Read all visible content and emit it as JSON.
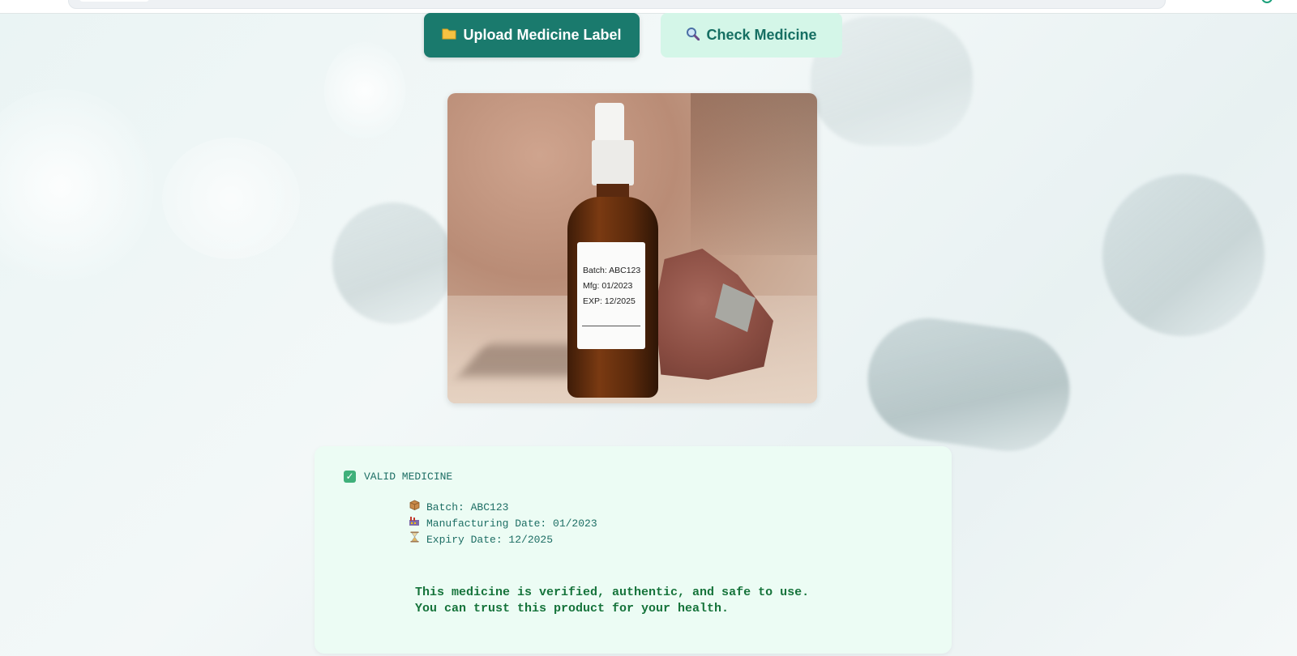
{
  "actions": {
    "upload_label": "Upload Medicine Label",
    "upload_icon": "folder-icon",
    "check_label": "Check Medicine",
    "check_icon": "magnifier-icon"
  },
  "photo_label": {
    "batch": "Batch: ABC123",
    "mfg": "Mfg: 01/2023",
    "exp": "EXP: 12/2025"
  },
  "result": {
    "status_text": "VALID MEDICINE",
    "status_color": "#3fb07a",
    "details": [
      {
        "icon": "package-icon",
        "text": "Batch: ABC123"
      },
      {
        "icon": "factory-icon",
        "text": "Manufacturing Date: 01/2023"
      },
      {
        "icon": "hourglass-icon",
        "text": "Expiry Date: 12/2025"
      }
    ],
    "message_line1": "This medicine is verified, authentic, and safe to use.",
    "message_line2": "You can trust this product for your health."
  },
  "colors": {
    "primary": "#1a7a6d",
    "secondary_bg": "#d4f6e8",
    "card_bg": "#ecfcf4",
    "message": "#15733a"
  }
}
